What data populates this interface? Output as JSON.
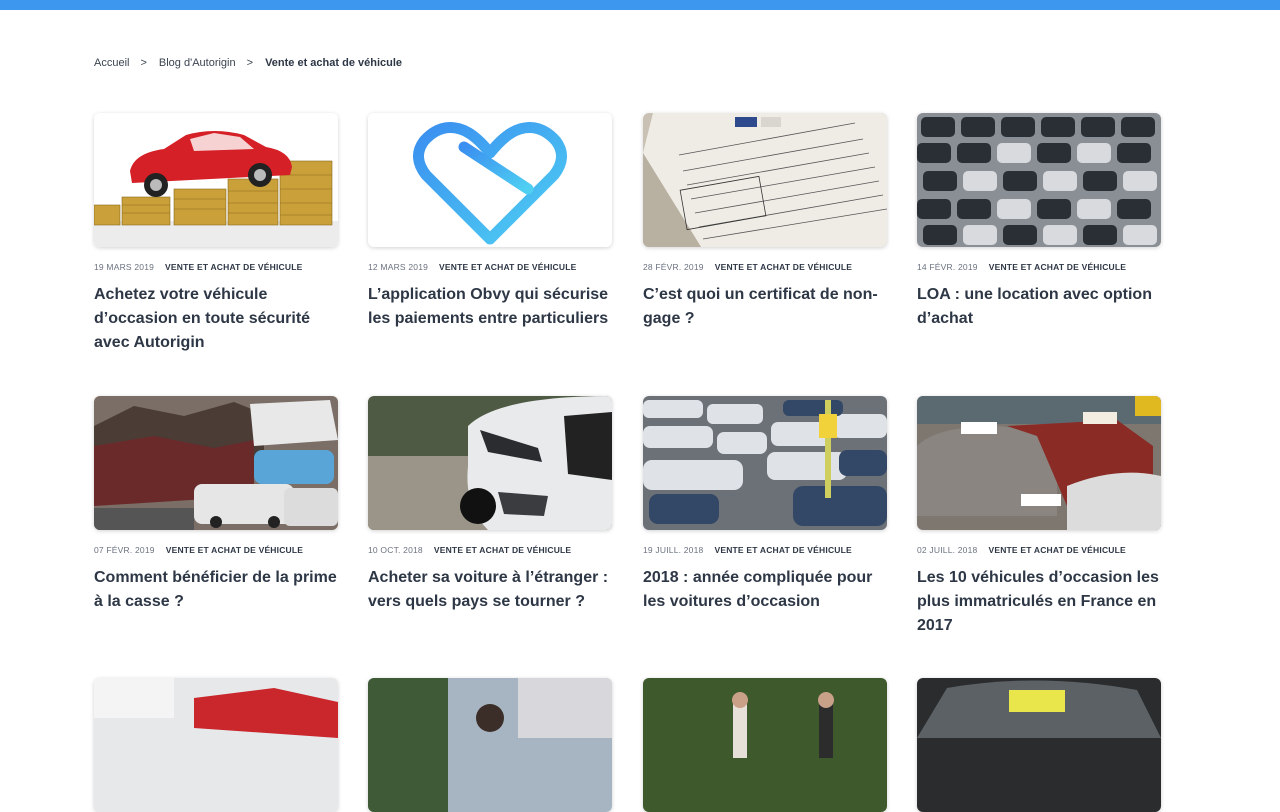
{
  "colors": {
    "accent_bar": "#3d97ee",
    "text": "#2e3746"
  },
  "breadcrumb": {
    "items": [
      "Accueil",
      "Blog d'Autorigin"
    ],
    "current": "Vente et achat de véhicule",
    "separator": ">"
  },
  "articles": [
    {
      "date": "19 MARS 2019",
      "category": "VENTE ET ACHAT DE VÉHICULE",
      "title": "Achetez votre véhicule d’occasion en toute sécurité avec Autorigin",
      "image": "red-car-on-coins"
    },
    {
      "date": "12 MARS 2019",
      "category": "VENTE ET ACHAT DE VÉHICULE",
      "title": "L’application Obvy qui sécurise les paiements entre particuliers",
      "image": "obvy-heart-logo"
    },
    {
      "date": "28 FÉVR. 2019",
      "category": "VENTE ET ACHAT DE VÉHICULE",
      "title": "C’est quoi un certificat de non-gage ?",
      "image": "certificate-document"
    },
    {
      "date": "14 FÉVR. 2019",
      "category": "VENTE ET ACHAT DE VÉHICULE",
      "title": "LOA : une location avec option d’achat",
      "image": "parking-lot-cars"
    },
    {
      "date": "07 FÉVR. 2019",
      "category": "VENTE ET ACHAT DE VÉHICULE",
      "title": "Comment bénéficier de la prime à la casse ?",
      "image": "scrapyard-cars"
    },
    {
      "date": "10 OCT. 2018",
      "category": "VENTE ET ACHAT DE VÉHICULE",
      "title": "Acheter sa voiture à l’étranger : vers quels pays se tourner ?",
      "image": "white-car-front"
    },
    {
      "date": "19 JUILL. 2018",
      "category": "VENTE ET ACHAT DE VÉHICULE",
      "title": "2018 : année compliquée pour les voitures d’occasion",
      "image": "used-car-lot"
    },
    {
      "date": "02 JUILL. 2018",
      "category": "VENTE ET ACHAT DE VÉHICULE",
      "title": "Les 10 véhicules d’occasion les plus immatriculés en France en 2017",
      "image": "dealer-lot-diesel"
    }
  ]
}
